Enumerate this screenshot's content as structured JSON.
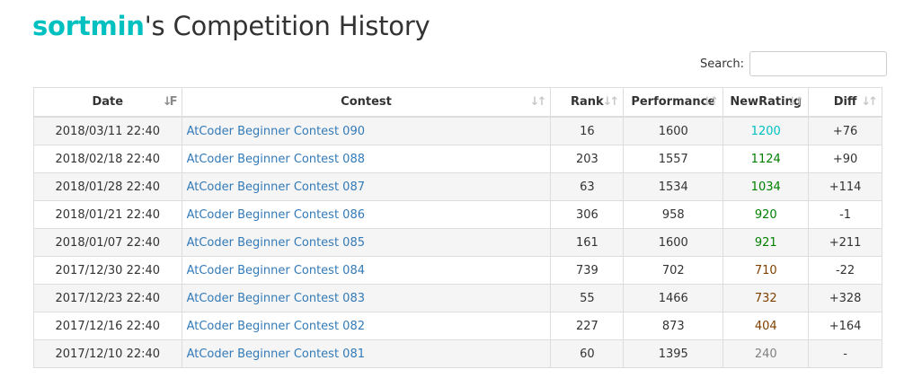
{
  "page": {
    "title_user": "sortmin",
    "title_rest": "'s Competition History"
  },
  "search": {
    "label": "Search:",
    "value": "",
    "placeholder": ""
  },
  "table": {
    "headers": [
      "Date",
      "Contest",
      "Rank",
      "Performance",
      "NewRating",
      "Diff"
    ],
    "rows": [
      {
        "date": "2018/03/11 22:40",
        "contest": "AtCoder Beginner Contest 090",
        "rank": "16",
        "performance": "1600",
        "new_rating": "1200",
        "rating_color": "cyan",
        "diff": "+76"
      },
      {
        "date": "2018/02/18 22:40",
        "contest": "AtCoder Beginner Contest 088",
        "rank": "203",
        "performance": "1557",
        "new_rating": "1124",
        "rating_color": "green",
        "diff": "+90"
      },
      {
        "date": "2018/01/28 22:40",
        "contest": "AtCoder Beginner Contest 087",
        "rank": "63",
        "performance": "1534",
        "new_rating": "1034",
        "rating_color": "green",
        "diff": "+114"
      },
      {
        "date": "2018/01/21 22:40",
        "contest": "AtCoder Beginner Contest 086",
        "rank": "306",
        "performance": "958",
        "new_rating": "920",
        "rating_color": "green",
        "diff": "-1"
      },
      {
        "date": "2018/01/07 22:40",
        "contest": "AtCoder Beginner Contest 085",
        "rank": "161",
        "performance": "1600",
        "new_rating": "921",
        "rating_color": "green",
        "diff": "+211"
      },
      {
        "date": "2017/12/30 22:40",
        "contest": "AtCoder Beginner Contest 084",
        "rank": "739",
        "performance": "702",
        "new_rating": "710",
        "rating_color": "brown",
        "diff": "-22"
      },
      {
        "date": "2017/12/23 22:40",
        "contest": "AtCoder Beginner Contest 083",
        "rank": "55",
        "performance": "1466",
        "new_rating": "732",
        "rating_color": "brown",
        "diff": "+328"
      },
      {
        "date": "2017/12/16 22:40",
        "contest": "AtCoder Beginner Contest 082",
        "rank": "227",
        "performance": "873",
        "new_rating": "404",
        "rating_color": "brown",
        "diff": "+164"
      },
      {
        "date": "2017/12/10 22:40",
        "contest": "AtCoder Beginner Contest 081",
        "rank": "60",
        "performance": "1395",
        "new_rating": "240",
        "rating_color": "gray",
        "diff": "-"
      }
    ]
  },
  "colors": {
    "user_accent": "#00c0c0",
    "link": "#337ab7",
    "rating_cyan": "#00c0c0",
    "rating_green": "#008000",
    "rating_brown": "#804000",
    "rating_gray": "#808080",
    "stripe": "#f5f5f5"
  },
  "icons": {
    "sort_active": "sort-amount-down-icon",
    "sort_inactive": "sort-arrows-icon"
  }
}
